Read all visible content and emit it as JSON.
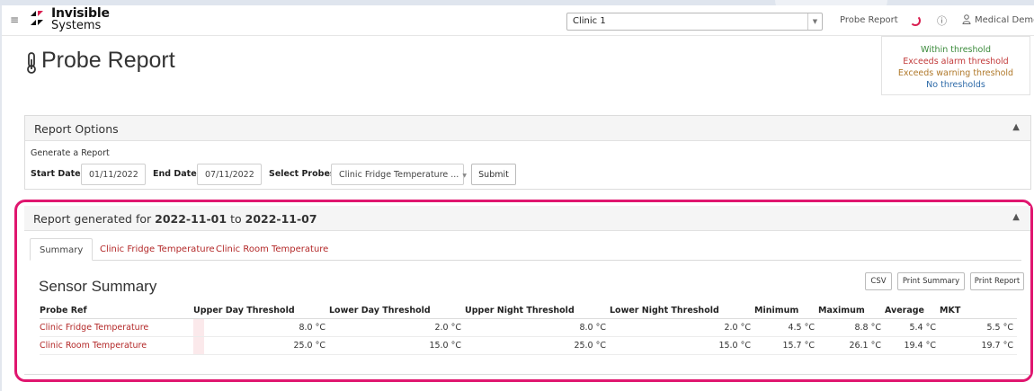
{
  "header": {
    "logo_line1": "Invisible",
    "logo_line2": "Systems",
    "clinic_selected": "Clinic 1",
    "probe_report_link": "Probe Report",
    "user_name": "Medical Demo",
    "icons": {
      "menu": "hamburger-icon",
      "help": "help-circle-icon",
      "user": "user-icon",
      "loading": "spinner-icon"
    }
  },
  "page": {
    "title": "Probe Report",
    "title_icon": "thermometer-icon"
  },
  "legend": {
    "within": "Within threshold",
    "alarm": "Exceeds alarm threshold",
    "warning": "Exceeds warning threshold",
    "none": "No thresholds",
    "colors": {
      "within": "#3a8a3a",
      "alarm": "#c23a3a",
      "warning": "#b0792b",
      "none": "#2d6aa8"
    }
  },
  "options": {
    "title": "Report Options",
    "generate_label": "Generate a Report",
    "start_label": "Start Date:",
    "start_value": "01/11/2022",
    "end_label": "End Date:",
    "end_value": "07/11/2022",
    "probes_label": "Select Probes:",
    "probes_value": "Clinic Fridge Temperature ...",
    "submit_label": "Submit"
  },
  "report": {
    "title_prefix": "Report generated for",
    "date_from": "2022-11-01",
    "title_to": "to",
    "date_to": "2022-11-07",
    "tabs": [
      "Summary",
      "Clinic Fridge Temperature",
      "Clinic Room Temperature"
    ],
    "active_tab": "Summary",
    "sensor_title": "Sensor Summary",
    "buttons": {
      "csv": "CSV",
      "print_summary": "Print Summary",
      "print_report": "Print Report"
    },
    "columns": [
      "Probe Ref",
      "Upper Day Threshold",
      "Lower Day Threshold",
      "Upper Night Threshold",
      "Lower Night Threshold",
      "Minimum",
      "Maximum",
      "Average",
      "MKT"
    ],
    "rows": [
      [
        "Clinic Fridge Temperature",
        "8.0 °C",
        "2.0 °C",
        "8.0 °C",
        "2.0 °C",
        "4.5 °C",
        "8.8 °C",
        "5.4 °C",
        "5.5 °C"
      ],
      [
        "Clinic Room Temperature",
        "25.0 °C",
        "15.0 °C",
        "25.0 °C",
        "15.0 °C",
        "15.7 °C",
        "26.1 °C",
        "19.4 °C",
        "19.7 °C"
      ]
    ],
    "highlight_color": "#e0166f"
  }
}
